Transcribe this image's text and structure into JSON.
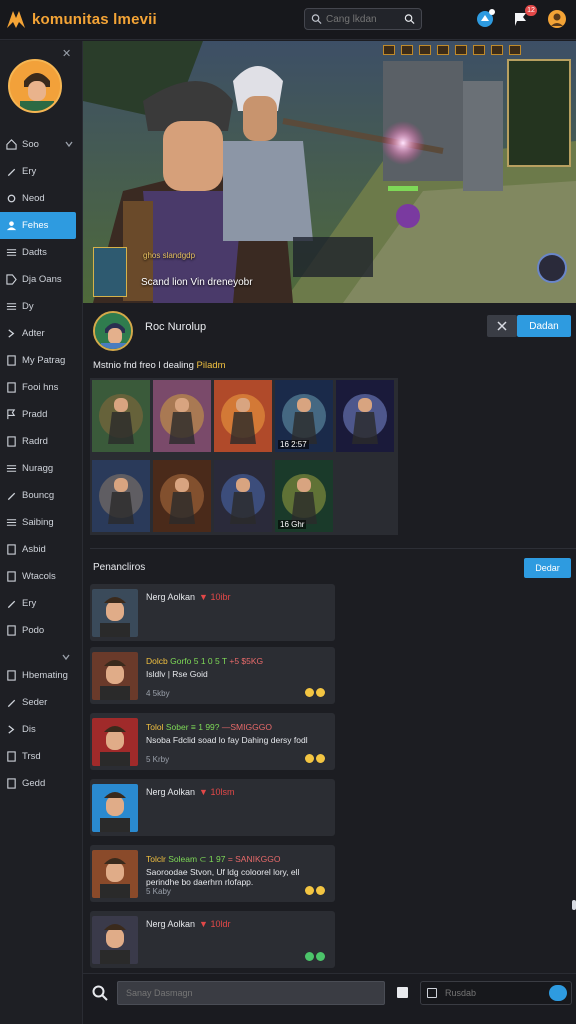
{
  "app": {
    "title": "komunitas lmevii",
    "brand_color": "#f4a436",
    "accent": "#2e9be0"
  },
  "search": {
    "placeholder": "Cang lkdan"
  },
  "topbar": {
    "notif_badge": "",
    "alert_badge": "12"
  },
  "sidebar": {
    "items": [
      {
        "label": "Soo",
        "icon": "home-icon",
        "has_chevron": true
      },
      {
        "label": "Ery",
        "icon": "pen-icon"
      },
      {
        "label": "Neod",
        "icon": "gear-icon"
      },
      {
        "label": "Fehes",
        "icon": "user-icon",
        "active": true
      },
      {
        "label": "Dadts",
        "icon": "list-icon"
      },
      {
        "label": "Dja Oans",
        "icon": "tag-icon"
      },
      {
        "label": "Dy",
        "icon": "list-icon"
      },
      {
        "label": "Adter",
        "icon": "chevron-icon"
      },
      {
        "label": "My Patrag",
        "icon": "doc-icon"
      },
      {
        "label": "Fooi hns",
        "icon": "doc-icon"
      },
      {
        "label": "Pradd",
        "icon": "flag-icon"
      },
      {
        "label": "Radrd",
        "icon": "doc-icon"
      },
      {
        "label": "Nuragg",
        "icon": "list-icon"
      },
      {
        "label": "Bouncg",
        "icon": "pen-icon"
      },
      {
        "label": "Saibing",
        "icon": "list-icon"
      },
      {
        "label": "Asbid",
        "icon": "doc-icon"
      },
      {
        "label": "Wtacols",
        "icon": "doc-icon"
      },
      {
        "label": "Ery",
        "icon": "pen-icon"
      },
      {
        "label": "Podo",
        "icon": "doc-icon"
      }
    ],
    "items2": [
      {
        "label": "Hbemating",
        "icon": "doc-icon"
      },
      {
        "label": "Seder",
        "icon": "pen-icon"
      },
      {
        "label": "Dis",
        "icon": "chevron-icon"
      },
      {
        "label": "Trsd",
        "icon": "doc-icon"
      },
      {
        "label": "Gedd",
        "icon": "doc-icon"
      }
    ]
  },
  "hero": {
    "caption": "Scand lion Vin dreneyobr",
    "sub": "ghos slandgdp"
  },
  "profile": {
    "name": "Roc Nurolup",
    "follow_label": "Dadan"
  },
  "gallery": {
    "title": "Mstnio fnd freo l dealing",
    "title_hl": "Piladm",
    "tiles": [
      {
        "tag": ""
      },
      {
        "tag": ""
      },
      {
        "tag": ""
      },
      {
        "tag": "16 2:57"
      },
      {
        "tag": ""
      },
      {
        "tag": ""
      },
      {
        "tag": ""
      },
      {
        "tag": ""
      },
      {
        "tag": "16 Ghr"
      }
    ]
  },
  "recent": {
    "title": "Penancliros",
    "button": "Dedar",
    "cards": [
      {
        "type": "name",
        "name": "Nerg Aolkan",
        "tag": "▼ 10ibr"
      },
      {
        "type": "stats",
        "line1a": "Dolcb",
        "line1b": "Gorfo 5 1 0 5 T",
        "line1c": "+5 $5KG",
        "line2": "Isldlv | Rse Goid",
        "meta": "4 5kby",
        "emo": "yellow"
      },
      {
        "type": "stats",
        "line1a": "Tolol",
        "line1b": "Sober ≡ 1 99?",
        "line1c": "—SMIGGGO",
        "line2": "Nsoba Fdclid soad lo fay Dahing dersy fodl",
        "meta": "5 Krby",
        "emo": "yellow"
      },
      {
        "type": "name",
        "name": "Nerg Aolkan",
        "tag": "▼ 10lsm"
      },
      {
        "type": "stats",
        "line1a": "Tolclr",
        "line1b": "Soleam ⊂ 1 97",
        "line1c": "= SANIKGGO",
        "line2": "Saoroodae Stvon, Uf ldg coloorel lory, ell",
        "line3": "perindhe bo daerhrn rlofapp.",
        "meta": "5 Kaby",
        "emo": "yellow"
      },
      {
        "type": "name",
        "name": "Nerg Aolkan",
        "tag": "▼ 10ldr",
        "emo": "green"
      }
    ]
  },
  "bottombar": {
    "search_placeholder": "Sanay Dasmagn",
    "msg_placeholder": "Rusdab"
  }
}
